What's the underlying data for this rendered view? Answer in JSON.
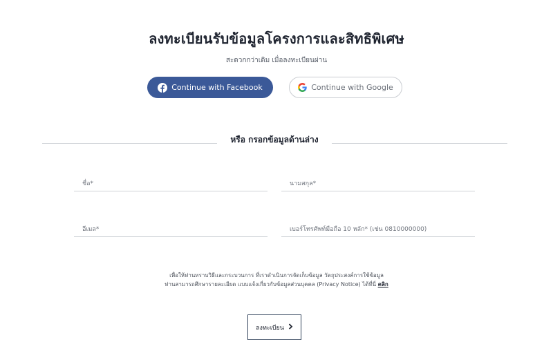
{
  "header": {
    "title": "ลงทะเบียนรับข้อมูลโครงการและสิทธิพิเศษ",
    "subtitle": "สะดวกกว่าเดิม เมื่อลงทะเบียนผ่าน"
  },
  "social": {
    "facebook_label": "Continue with Facebook",
    "google_label": "Continue with Google",
    "facebook_icon": "facebook-icon",
    "google_icon": "google-icon",
    "facebook_color": "#3b5998"
  },
  "divider": {
    "label": "หรือ กรอกข้อมูลด้านล่าง"
  },
  "form": {
    "first_name_placeholder": "ชื่อ*",
    "last_name_placeholder": "นามสกุล*",
    "email_placeholder": "อีเมล*",
    "phone_placeholder": "เบอร์โทรศัพท์มือถือ 10 หลัก* (เช่น 0810000000)"
  },
  "notice": {
    "line1": "เพื่อให้ท่านทราบวิธีและกระบวนการ ที่เราดำเนินการจัดเก็บข้อมูล วัตถุประสงค์การใช้ข้อมูล",
    "line2": "ท่านสามารถศึกษารายละเอียด แบบแจ้งเกี่ยวกับข้อมูลส่วนบุคคล (Privacy Notice) ได้ที่นี่",
    "link_label": "คลิก"
  },
  "submit": {
    "label": "ลงทะเบียน",
    "icon": "chevron-right-icon"
  }
}
